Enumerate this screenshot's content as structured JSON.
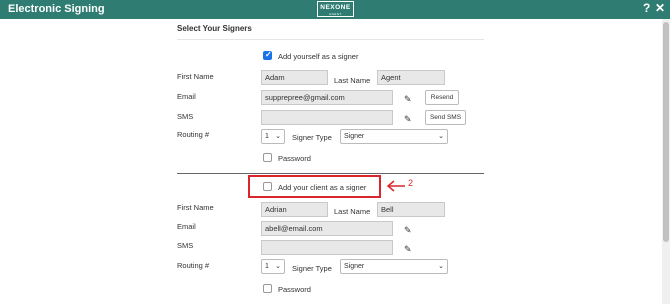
{
  "app": {
    "title": "Electronic Signing",
    "logo_main": "NEXONE",
    "logo_sub": "AGENT",
    "help_icon": "?",
    "close_icon": "✕"
  },
  "form": {
    "section_title": "Select Your Signers",
    "self": {
      "checkbox_label": "Add yourself as a signer",
      "checked": true,
      "first_name_label": "First Name",
      "first_name": "Adam",
      "last_name_label": "Last Name",
      "last_name": "Agent",
      "email_label": "Email",
      "email": "supprepree@gmail.com",
      "resend_label": "Resend",
      "sms_label": "SMS",
      "sms": "",
      "send_sms_label": "Send SMS",
      "routing_label": "Routing #",
      "routing_value": "1",
      "signer_type_label": "Signer Type",
      "signer_type_value": "Signer",
      "password_label": "Password"
    },
    "client": {
      "checkbox_label": "Add your client as a signer",
      "checked": false,
      "first_name_label": "First Name",
      "first_name": "Adrian",
      "last_name_label": "Last Name",
      "last_name": "Bell",
      "email_label": "Email",
      "email": "abell@email.com",
      "sms_label": "SMS",
      "sms": "",
      "routing_label": "Routing #",
      "routing_value": "1",
      "signer_type_label": "Signer Type",
      "signer_type_value": "Signer",
      "password_label": "Password"
    }
  },
  "annotation": {
    "step_number": "2",
    "color": "#d9262c"
  },
  "colors": {
    "titlebar": "#2f7d72",
    "checkbox_checked": "#1a73e8"
  },
  "icons": {
    "edit": "pencil-icon",
    "caret": "chevron-down-icon"
  }
}
